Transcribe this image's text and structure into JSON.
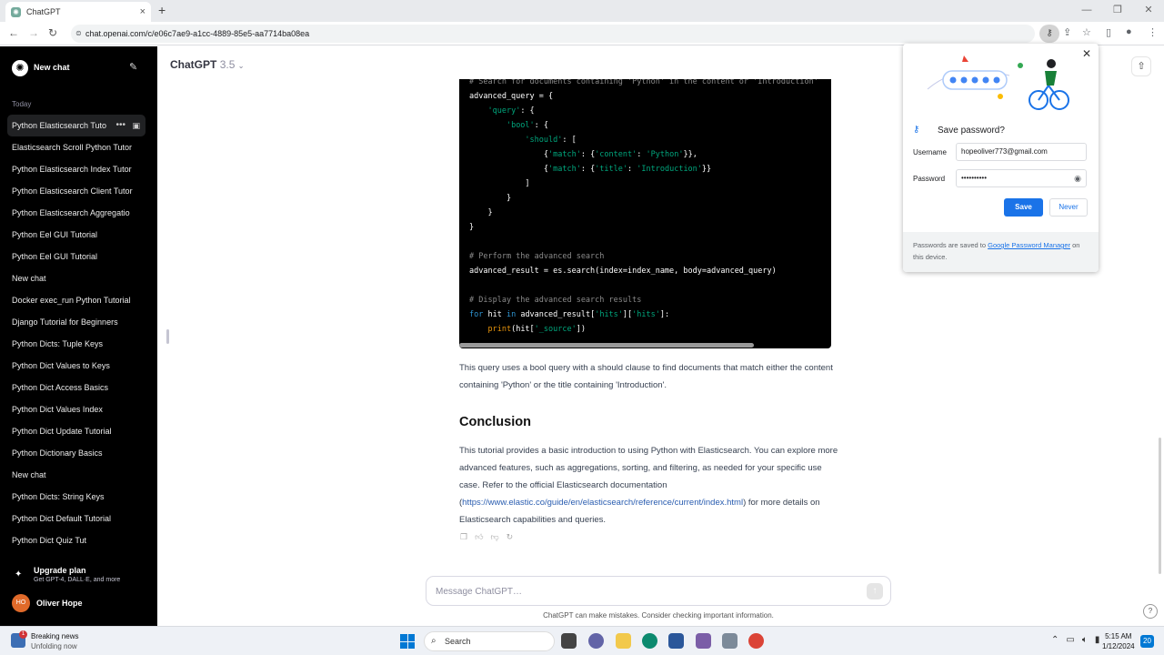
{
  "browser": {
    "tab_title": "ChatGPT",
    "url": "chat.openai.com/c/e06c7ae9-a1cc-4889-85e5-aa7714ba08ea"
  },
  "sidebar": {
    "new_chat": "New chat",
    "section_today": "Today",
    "items": [
      {
        "label": "Python Elasticsearch Tuto"
      },
      {
        "label": "Elasticsearch Scroll Python Tutor"
      },
      {
        "label": "Python Elasticsearch Index Tutor"
      },
      {
        "label": "Python Elasticsearch Client Tutor"
      },
      {
        "label": "Python Elasticsearch Aggregatio"
      },
      {
        "label": "Python Eel GUI Tutorial"
      },
      {
        "label": "Python Eel GUI Tutorial"
      },
      {
        "label": "New chat"
      },
      {
        "label": "Docker exec_run Python Tutorial"
      },
      {
        "label": "Django Tutorial for Beginners"
      },
      {
        "label": "Python Dicts: Tuple Keys"
      },
      {
        "label": "Python Dict Values to Keys"
      },
      {
        "label": "Python Dict Access Basics"
      },
      {
        "label": "Python Dict Values Index"
      },
      {
        "label": "Python Dict Update Tutorial"
      },
      {
        "label": "Python Dictionary Basics"
      },
      {
        "label": "New chat"
      },
      {
        "label": "Python Dicts: String Keys"
      },
      {
        "label": "Python Dict Default Tutorial"
      },
      {
        "label": "Python Dict Quiz Tut"
      }
    ],
    "upgrade_title": "Upgrade plan",
    "upgrade_sub": "Get GPT-4, DALL·E, and more",
    "user_initials": "HO",
    "user_name": "Oliver Hope"
  },
  "main": {
    "model_name": "ChatGPT",
    "model_version": "3.5",
    "paragraph1": "This query uses a bool query with a should clause to find documents that match either the content containing 'Python' or the title containing 'Introduction'.",
    "heading": "Conclusion",
    "paragraph2_before": "This tutorial provides a basic introduction to using Python with Elasticsearch. You can explore more advanced features, such as aggregations, sorting, and filtering, as needed for your specific use case. Refer to the official Elasticsearch documentation (",
    "paragraph2_link": "https://www.elastic.co/guide/en/elasticsearch/reference/current/index.html",
    "paragraph2_after": ") for more details on Elasticsearch capabilities and queries.",
    "message_placeholder": "Message ChatGPT…",
    "disclaimer": "ChatGPT can make mistakes. Consider checking important information.",
    "help": "?"
  },
  "code": {
    "line0": "# Search for documents containing 'Python' in the content or 'Introduction'",
    "line1": "advanced_query = {",
    "line2_key": "'query'",
    "line3_key": "'bool'",
    "line4_key": "'should'",
    "line5_a": "'match'",
    "line5_b": "'content'",
    "line5_c": "'Python'",
    "line6_a": "'match'",
    "line6_b": "'title'",
    "line6_c": "'Introduction'",
    "comment1": "# Perform the advanced search",
    "line_search": "advanced_result = es.search(index=index_name, body=advanced_query)",
    "comment2": "# Display the advanced search results",
    "for_kw": "for",
    "for_var": " hit ",
    "in_kw": "in",
    "for_rest": " advanced_result[",
    "hits1": "'hits'",
    "hits2": "'hits'",
    "print_fn": "print",
    "print_arg": "'_source'"
  },
  "password_popup": {
    "title": "Save password?",
    "username_label": "Username",
    "username_value": "hopeoliver773@gmail.com",
    "password_label": "Password",
    "password_value": "••••••••••",
    "save": "Save",
    "never": "Never",
    "footer_before": "Passwords are saved to ",
    "footer_link": "Google Password Manager",
    "footer_after": " on this device."
  },
  "taskbar": {
    "news_title": "Breaking news",
    "news_sub": "Unfolding now",
    "news_badge": "1",
    "search": "Search",
    "time": "5:15 AM",
    "date": "1/12/2024",
    "notifications": "20"
  },
  "colors": {
    "sidebar_bg": "#000000",
    "accent_blue": "#1a73e8",
    "code_string": "#00a67d",
    "code_keyword": "#2e95d3"
  }
}
